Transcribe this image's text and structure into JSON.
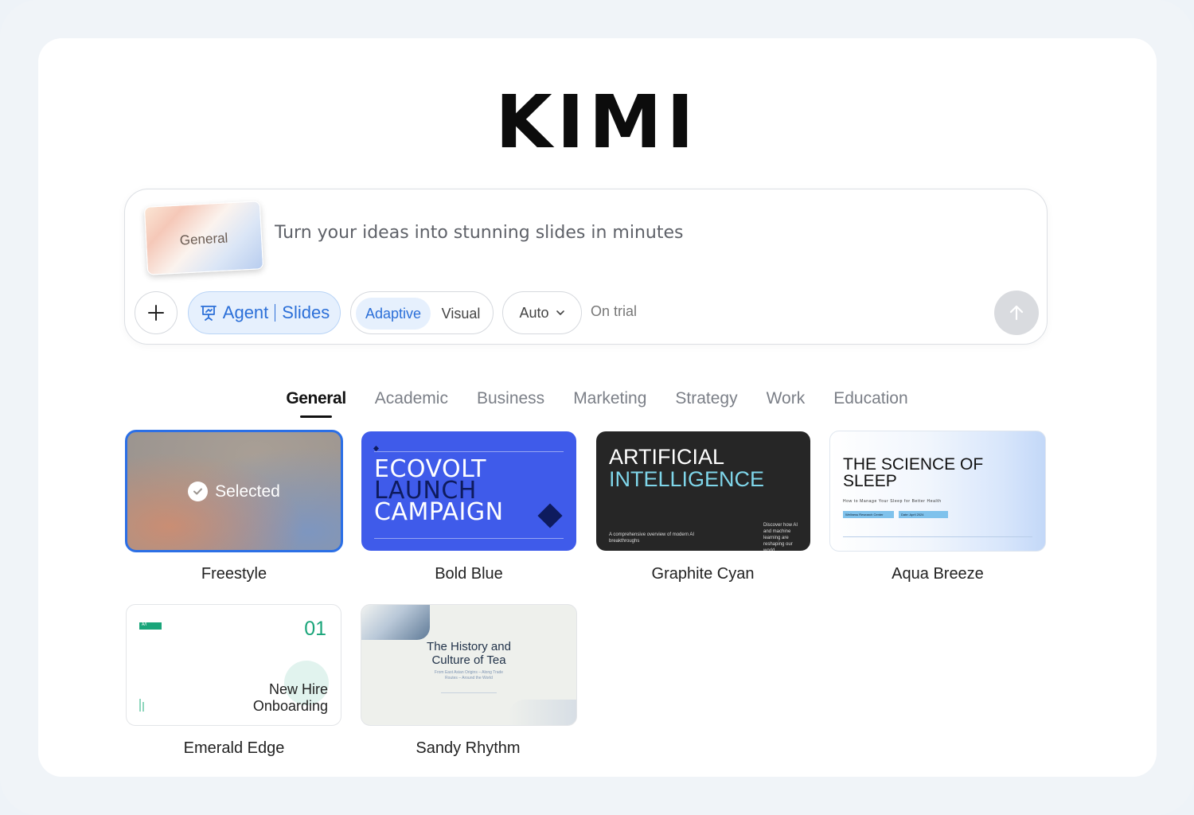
{
  "logo": "KIMI",
  "composer": {
    "template_chip_label": "General",
    "prompt_placeholder": "Turn your ideas into stunning slides in minutes",
    "agent_label": "Agent",
    "slides_label": "Slides",
    "mode_adaptive": "Adaptive",
    "mode_visual": "Visual",
    "mode_selected": "Adaptive",
    "model_select": "Auto",
    "trial_text": "On trial"
  },
  "tabs": [
    {
      "label": "General",
      "active": true
    },
    {
      "label": "Academic",
      "active": false
    },
    {
      "label": "Business",
      "active": false
    },
    {
      "label": "Marketing",
      "active": false
    },
    {
      "label": "Strategy",
      "active": false
    },
    {
      "label": "Work",
      "active": false
    },
    {
      "label": "Education",
      "active": false
    }
  ],
  "templates": [
    {
      "name": "Freestyle",
      "selected": true,
      "selected_label": "Selected"
    },
    {
      "name": "Bold Blue",
      "preview": {
        "title_lines": [
          "ECOVOLT",
          "LAUNCH",
          "CAMPAIGN"
        ]
      }
    },
    {
      "name": "Graphite Cyan",
      "preview": {
        "title_lines": [
          "ARTIFICIAL",
          "INTELLIGENCE"
        ],
        "footer_left": "A comprehensive overview of modern AI breakthroughs",
        "footer_right": "Discover how AI and machine learning are reshaping our world"
      }
    },
    {
      "name": "Aqua Breeze",
      "preview": {
        "title_lines": [
          "THE SCIENCE OF",
          "SLEEP"
        ],
        "subtitle": "How to Manage Your Sleep for Better Health",
        "tag1": "Wellness Research Center",
        "tag2": "Date: April 2024"
      }
    },
    {
      "name": "Emerald Edge",
      "preview": {
        "number": "01",
        "title_lines": [
          "New Hire",
          "Onboarding"
        ]
      }
    },
    {
      "name": "Sandy Rhythm",
      "preview": {
        "title_lines": [
          "The History and",
          "Culture of Tea"
        ],
        "subtitle_lines": [
          "From East Asian Origins – Along Trade",
          "Routes – Around the World"
        ]
      }
    }
  ],
  "colors": {
    "accent": "#2b6fd8",
    "selected_border": "#2b6fe6",
    "bold_blue": "#3f5bea",
    "graphite": "#262626",
    "cyan": "#7fd6ea",
    "emerald": "#1aa57a"
  },
  "icons": {
    "add": "plus-icon",
    "agent": "presentation-icon",
    "dropdown": "chevron-down-icon",
    "send": "arrow-up-icon",
    "selected": "check-icon"
  }
}
